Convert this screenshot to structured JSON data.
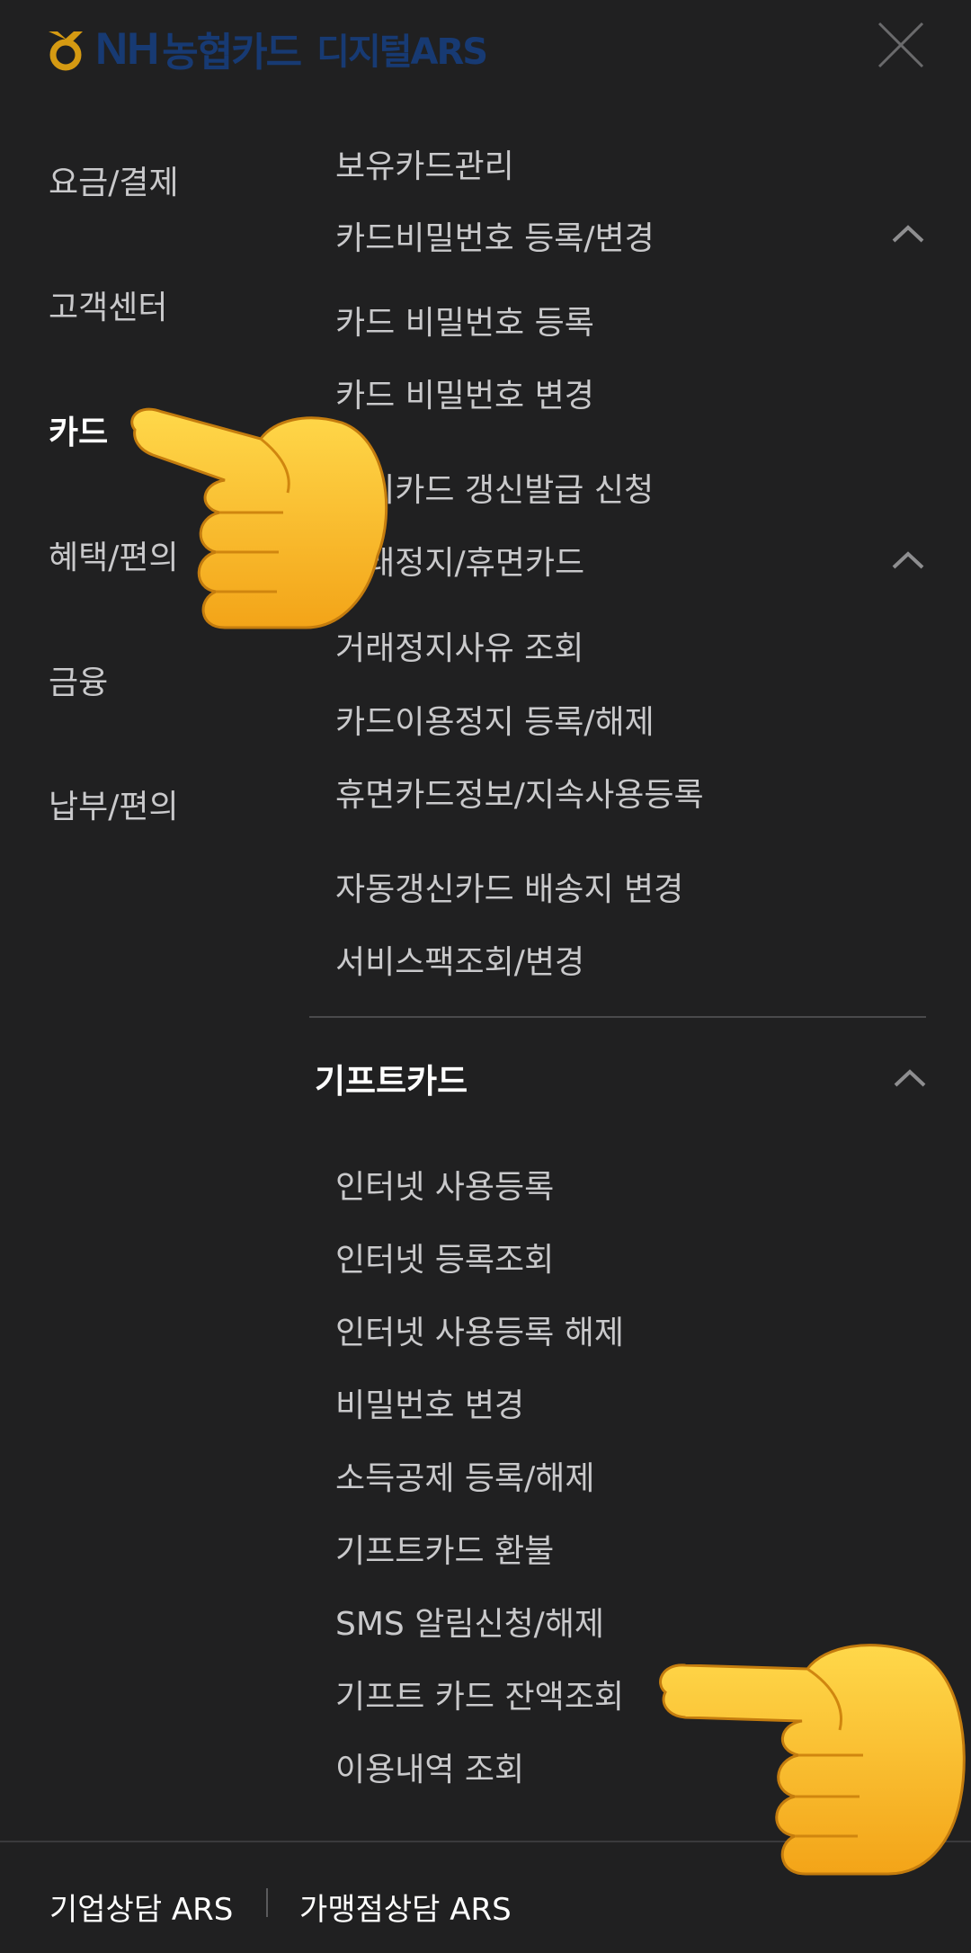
{
  "header": {
    "logo_nh": "NH",
    "logo_card": "농협카드",
    "logo_sub": "디지털ARS",
    "close_icon": "close-icon",
    "brand_color": "#173a73",
    "mark_color": "#d59a12"
  },
  "categories": [
    {
      "label": "요금/결제"
    },
    {
      "label": "고객센터"
    },
    {
      "label": "카드"
    },
    {
      "label": "혜택/편의"
    },
    {
      "label": "금융"
    },
    {
      "label": "납부/편의"
    }
  ],
  "menu": {
    "owned_card": "보유카드관리",
    "pin_group": "카드비밀번호 등록/변경",
    "pin_register": "카드 비밀번호 등록",
    "pin_change": "카드 비밀번호 변경",
    "renewal_apply": "만기카드 갱신발급 신청",
    "suspend_group": "거래정지/휴면카드",
    "suspend_reason": "거래정지사유 조회",
    "use_stop": "카드이용정지 등록/해제",
    "dormant_info": "휴면카드정보/지속사용등록",
    "auto_renew_address": "자동갱신카드 배송지 변경",
    "service_pack": "서비스팩조회/변경"
  },
  "gift": {
    "title": "기프트카드",
    "items": [
      {
        "label": "인터넷 사용등록"
      },
      {
        "label": "인터넷 등록조회"
      },
      {
        "label": "인터넷 사용등록 해제"
      },
      {
        "label": "비밀번호 변경"
      },
      {
        "label": "소득공제 등록/해제"
      },
      {
        "label": "기프트카드 환불"
      },
      {
        "label": "SMS 알림신청/해제"
      },
      {
        "label": "기프트 카드 잔액조회"
      },
      {
        "label": "이용내역 조회"
      }
    ]
  },
  "footer": {
    "corporate": "기업상담 ARS",
    "merchant": "가맹점상담 ARS"
  },
  "icons": {
    "chevron": "chevron-up-icon",
    "pointer": "pointing-hand-icon"
  }
}
